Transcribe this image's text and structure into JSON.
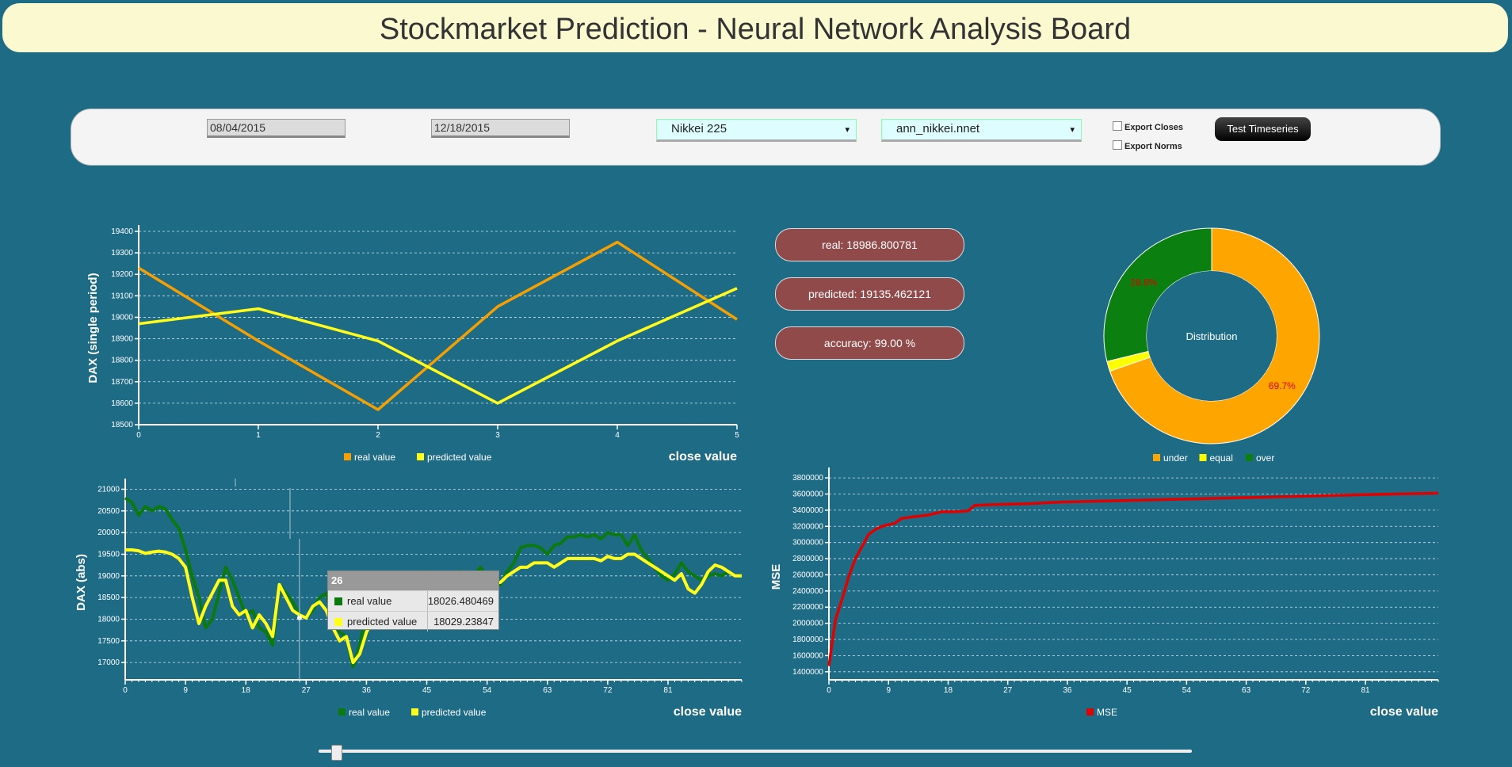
{
  "header": {
    "title": "Stockmarket Prediction - Neural Network Analysis Board"
  },
  "controls": {
    "start_date": "08/04/2015",
    "end_date": "12/18/2015",
    "index_select": "Nikkei 225",
    "network_select": "ann_nikkei.nnet",
    "export_closes_label": "Export Closes",
    "export_norms_label": "Export Norms",
    "test_button_label": "Test Timeseries",
    "select_arrow": "▾"
  },
  "stats": {
    "real": "real: 18986.800781",
    "predicted": "predicted: 19135.462121",
    "accuracy": "accuracy: 99.00 %"
  },
  "colors": {
    "real_period": "#f5a000",
    "predicted": "#ffff1a",
    "real_abs": "#0a7a10",
    "mse": "#e00000",
    "under": "#ffa500",
    "equal": "#ffff00",
    "over": "#0b8010"
  },
  "tooltip": {
    "index": "26",
    "real_label": "real value",
    "real_value": "18026.480469",
    "pred_label": "predicted value",
    "pred_value": "18029.23847"
  },
  "slider": {
    "position": 0.02
  },
  "chart_data": [
    {
      "type": "line",
      "ylabel": "DAX (single period)",
      "xlabel": "close value",
      "x": [
        0,
        1,
        2,
        3,
        4,
        5
      ],
      "ylim": [
        18500,
        19400
      ],
      "yticks": [
        18500,
        18600,
        18700,
        18800,
        18900,
        19000,
        19100,
        19200,
        19300,
        19400
      ],
      "series": [
        {
          "name": "real value",
          "values": [
            19230,
            18890,
            18570,
            19050,
            19350,
            18990
          ]
        },
        {
          "name": "predicted value",
          "values": [
            18970,
            19040,
            18890,
            18600,
            18890,
            19135
          ]
        }
      ]
    },
    {
      "type": "line",
      "ylabel": "DAX (abs)",
      "xlabel": "close value",
      "xlim": [
        0,
        92
      ],
      "xticks": [
        0,
        9,
        18,
        27,
        36,
        45,
        54,
        63,
        72,
        81
      ],
      "ylim": [
        16600,
        21100
      ],
      "yticks": [
        17000,
        17500,
        18000,
        18500,
        19000,
        19500,
        20000,
        20500,
        21000
      ],
      "series": [
        {
          "name": "real value",
          "values": [
            20800,
            20700,
            20400,
            20600,
            20500,
            20600,
            20550,
            20300,
            20100,
            19600,
            19000,
            18500,
            17800,
            18000,
            18600,
            19200,
            18900,
            18500,
            18100,
            18200,
            17800,
            17700,
            17400,
            18800,
            18600,
            18400,
            18100,
            18030,
            18200,
            18500,
            18600,
            18000,
            17700,
            17600,
            16900,
            17400,
            18200,
            18500,
            18600,
            18700,
            18800,
            18900,
            18700,
            18900,
            19000,
            19100,
            18900,
            18800,
            18900,
            19000,
            19100,
            19000,
            19000,
            19200,
            19000,
            18700,
            18800,
            19100,
            19300,
            19650,
            19700,
            19700,
            19650,
            19500,
            19700,
            19750,
            19900,
            19900,
            19950,
            19900,
            19950,
            19850,
            20000,
            19950,
            19950,
            19700,
            19950,
            19600,
            19400,
            19200,
            19000,
            18900,
            19050,
            19300,
            19100,
            19000,
            18900,
            19000,
            19050,
            19000,
            19100,
            19000,
            19000
          ]
        },
        {
          "name": "predicted value",
          "values": [
            19600,
            19600,
            19580,
            19520,
            19550,
            19570,
            19550,
            19500,
            19400,
            19200,
            18500,
            17900,
            18300,
            18600,
            18900,
            18900,
            18300,
            18100,
            18200,
            17800,
            18100,
            17900,
            17600,
            18800,
            18500,
            18200,
            18100,
            18029,
            18300,
            18400,
            18200,
            17800,
            17500,
            17600,
            17000,
            17200,
            17700,
            18000,
            18200,
            18300,
            18400,
            18400,
            18200,
            18300,
            18200,
            18200,
            18400,
            18500,
            18700,
            18800,
            18800,
            18900,
            18800,
            18900,
            18900,
            18850,
            18850,
            19000,
            19100,
            19200,
            19200,
            19300,
            19300,
            19300,
            19200,
            19300,
            19400,
            19400,
            19400,
            19400,
            19400,
            19350,
            19450,
            19400,
            19400,
            19500,
            19500,
            19400,
            19300,
            19200,
            19100,
            19000,
            18900,
            19050,
            18700,
            18600,
            18800,
            19100,
            19250,
            19200,
            19100,
            19000,
            19000
          ]
        }
      ]
    },
    {
      "type": "line",
      "ylabel": "MSE",
      "xlabel": "close value",
      "xlim": [
        0,
        92
      ],
      "xticks": [
        0,
        9,
        18,
        27,
        36,
        45,
        54,
        63,
        72,
        81
      ],
      "ylim": [
        1300000,
        3850000
      ],
      "yticks": [
        1400000,
        1600000,
        1800000,
        2000000,
        2200000,
        2400000,
        2600000,
        2800000,
        3000000,
        3200000,
        3400000,
        3600000,
        3800000
      ],
      "series": [
        {
          "name": "MSE",
          "values": [
            [
              0,
              1470000
            ],
            [
              1,
              2050000
            ],
            [
              2,
              2300000
            ],
            [
              3,
              2580000
            ],
            [
              4,
              2800000
            ],
            [
              5,
              2950000
            ],
            [
              6,
              3100000
            ],
            [
              7,
              3160000
            ],
            [
              8,
              3200000
            ],
            [
              9,
              3220000
            ],
            [
              10,
              3240000
            ],
            [
              11,
              3300000
            ],
            [
              13,
              3320000
            ],
            [
              15,
              3340000
            ],
            [
              17,
              3380000
            ],
            [
              19,
              3380000
            ],
            [
              21,
              3390000
            ],
            [
              22,
              3460000
            ],
            [
              25,
              3470000
            ],
            [
              30,
              3480000
            ],
            [
              35,
              3500000
            ],
            [
              45,
              3520000
            ],
            [
              55,
              3540000
            ],
            [
              65,
              3560000
            ],
            [
              75,
              3580000
            ],
            [
              85,
              3600000
            ],
            [
              92,
              3610000
            ]
          ]
        }
      ]
    },
    {
      "type": "pie",
      "title": "Distribution",
      "categories": [
        "under",
        "equal",
        "over"
      ],
      "values": [
        69.7,
        1.5,
        28.8
      ],
      "labels": [
        "69.7%",
        "",
        "28.8%"
      ]
    }
  ]
}
